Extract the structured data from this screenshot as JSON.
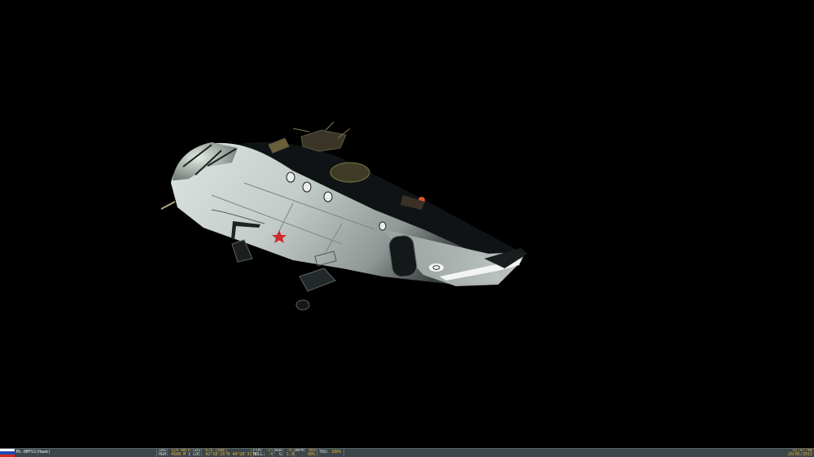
{
  "unit": {
    "name": "Mi-8MTV2(Hawk)",
    "flag_colors": [
      "#ffffff",
      "#1f49b4",
      "#d52b1e"
    ]
  },
  "hud": {
    "ias_label": "IAS:",
    "ias_value": "114 km/h",
    "crs_label": "CRS:",
    "crs_value": "078 (ENE)",
    "hgh_label": "HGH:",
    "hgh_value": "4588 M",
    "loc_label": "1 LOC:",
    "loc_value": "42°18'25\"N 44°28'37\"E",
    "pth_label": "PTH:",
    "pth_value": "-3°",
    "roll_label": "ROLL:",
    "roll_value": "-4°",
    "aoa_label": "AOA:",
    "aoa_value": "-0.9°",
    "g_label": "G:",
    "g_value": "1.0",
    "rpm_label": "RPM:",
    "rpm_value_1": "90%",
    "rpm_value_2": "90%",
    "trq_label": "TRQ:",
    "trq_value": "100%"
  },
  "clock": {
    "time": "01:47:48",
    "date": "20/05/2011"
  },
  "scene": {
    "sky_color": "#000000",
    "fuselage_color": "#c9d2cf",
    "marking": "red-star"
  }
}
